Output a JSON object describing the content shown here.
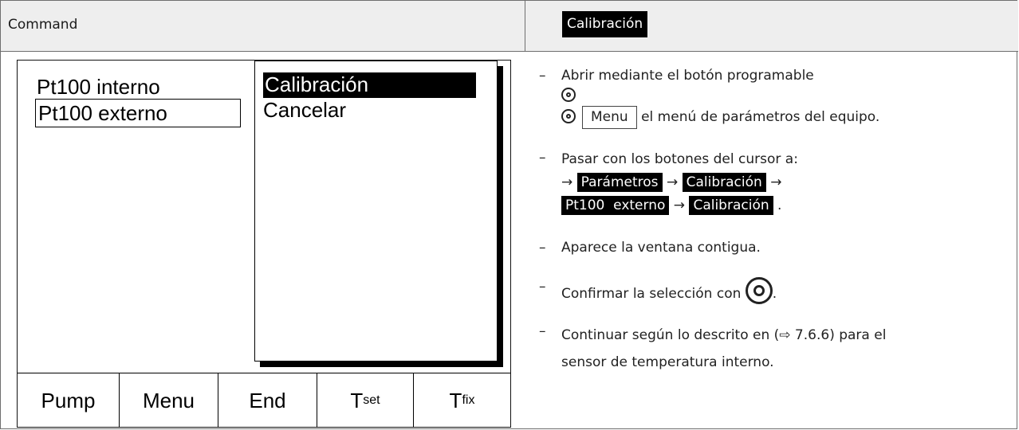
{
  "header": {
    "left_title": "Command",
    "right_title": "Calibración"
  },
  "display": {
    "sensors": [
      "Pt100 interno",
      "Pt100 externo"
    ],
    "popup": [
      "Calibración",
      "Cancelar"
    ],
    "softkeys": [
      {
        "label": "Pump",
        "sub": ""
      },
      {
        "label": "Menu",
        "sub": ""
      },
      {
        "label": "End",
        "sub": ""
      },
      {
        "label": "T",
        "sub": "set"
      },
      {
        "label": "T",
        "sub": "fix"
      }
    ]
  },
  "steps": {
    "dash": "–",
    "s1_text": "Abrir mediante el botón programable",
    "s1_menu": "Menu",
    "s1_tail": "el menú de parámetros del equipo.",
    "s2_text": "Pasar con los botones del cursor a:",
    "arrow": "→",
    "chip_parametros": "Parámetros",
    "chip_calibracion": "Calibración",
    "chip_pt100": "Pt100  externo",
    "chip_calibracion2": "Calibración",
    "period": ".",
    "s3_text": "Aparece la ventana contigua.",
    "s4_text": "Confirmar la selección con",
    "s5_line1": "Continuar según lo descrito en (⇨ 7.6.6) para el",
    "s5_line2": "sensor de temperatura interno."
  }
}
